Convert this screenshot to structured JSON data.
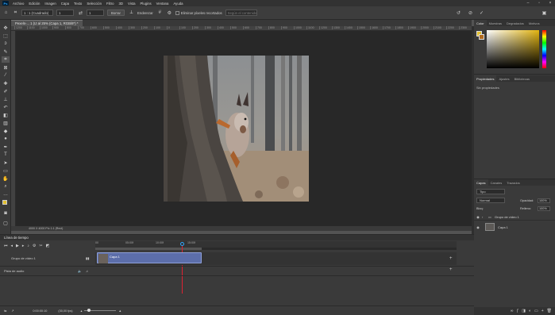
{
  "app": {
    "logo": "Ps"
  },
  "menu": [
    "Archivo",
    "Edición",
    "Imagen",
    "Capa",
    "Texto",
    "Selección",
    "Filtro",
    "3D",
    "Vista",
    "Plugins",
    "Ventana",
    "Ayuda"
  ],
  "options": {
    "ratio": "1 : 1 (Cuadrado)",
    "value1": "1",
    "value2": "1",
    "clear": "Borrar",
    "straighten": "Enderezar",
    "delete_cropped": "Eliminar píxeles recortados",
    "fill": "Según el contenido"
  },
  "doc_tab": "Pexels-... 1 (IJ al 25% (Capa 1, RGB/8*) *",
  "ruler_ticks": [
    "1200",
    "1100",
    "1000",
    "900",
    "800",
    "700",
    "600",
    "500",
    "400",
    "300",
    "200",
    "100",
    "0",
    "100",
    "200",
    "300",
    "400",
    "500",
    "600",
    "700",
    "800",
    "900",
    "1000",
    "1100",
    "1200",
    "1300",
    "1400",
    "1500",
    "1600",
    "1700",
    "1800",
    "1900",
    "2000",
    "2100",
    "2200",
    "2300"
  ],
  "status": "4000 X 4000 Píx 1:1 (Rect)",
  "color_panel": {
    "tabs": [
      "Color",
      "Muestras",
      "Degradados",
      "Motivos"
    ],
    "fg": "#e2c030"
  },
  "props_panel": {
    "tabs": [
      "Propiedades",
      "Ajustes",
      "Bibliotecas"
    ],
    "empty": "Sin propiedades"
  },
  "layers_panel": {
    "tabs": [
      "Capas",
      "Canales",
      "Trazados"
    ],
    "filter": "Tipo",
    "blend": "Normal",
    "opacity_label": "Opacidad:",
    "opacity": "100%",
    "lock_label": "Bloq:",
    "fill_label": "Relleno:",
    "fill": "100%",
    "group": "Grupo de vídeo 1",
    "layer": "Capa 1"
  },
  "timeline": {
    "title": "Línea de tiempo",
    "times": [
      "00",
      "05:00f",
      "10:00f",
      "15:00f"
    ],
    "track1": "Grupo de vídeo 1",
    "track2": "Pista de audio",
    "clip": "Capa 1",
    "timecode": "0:00:00:10",
    "fps": "(30,00 fps)"
  }
}
